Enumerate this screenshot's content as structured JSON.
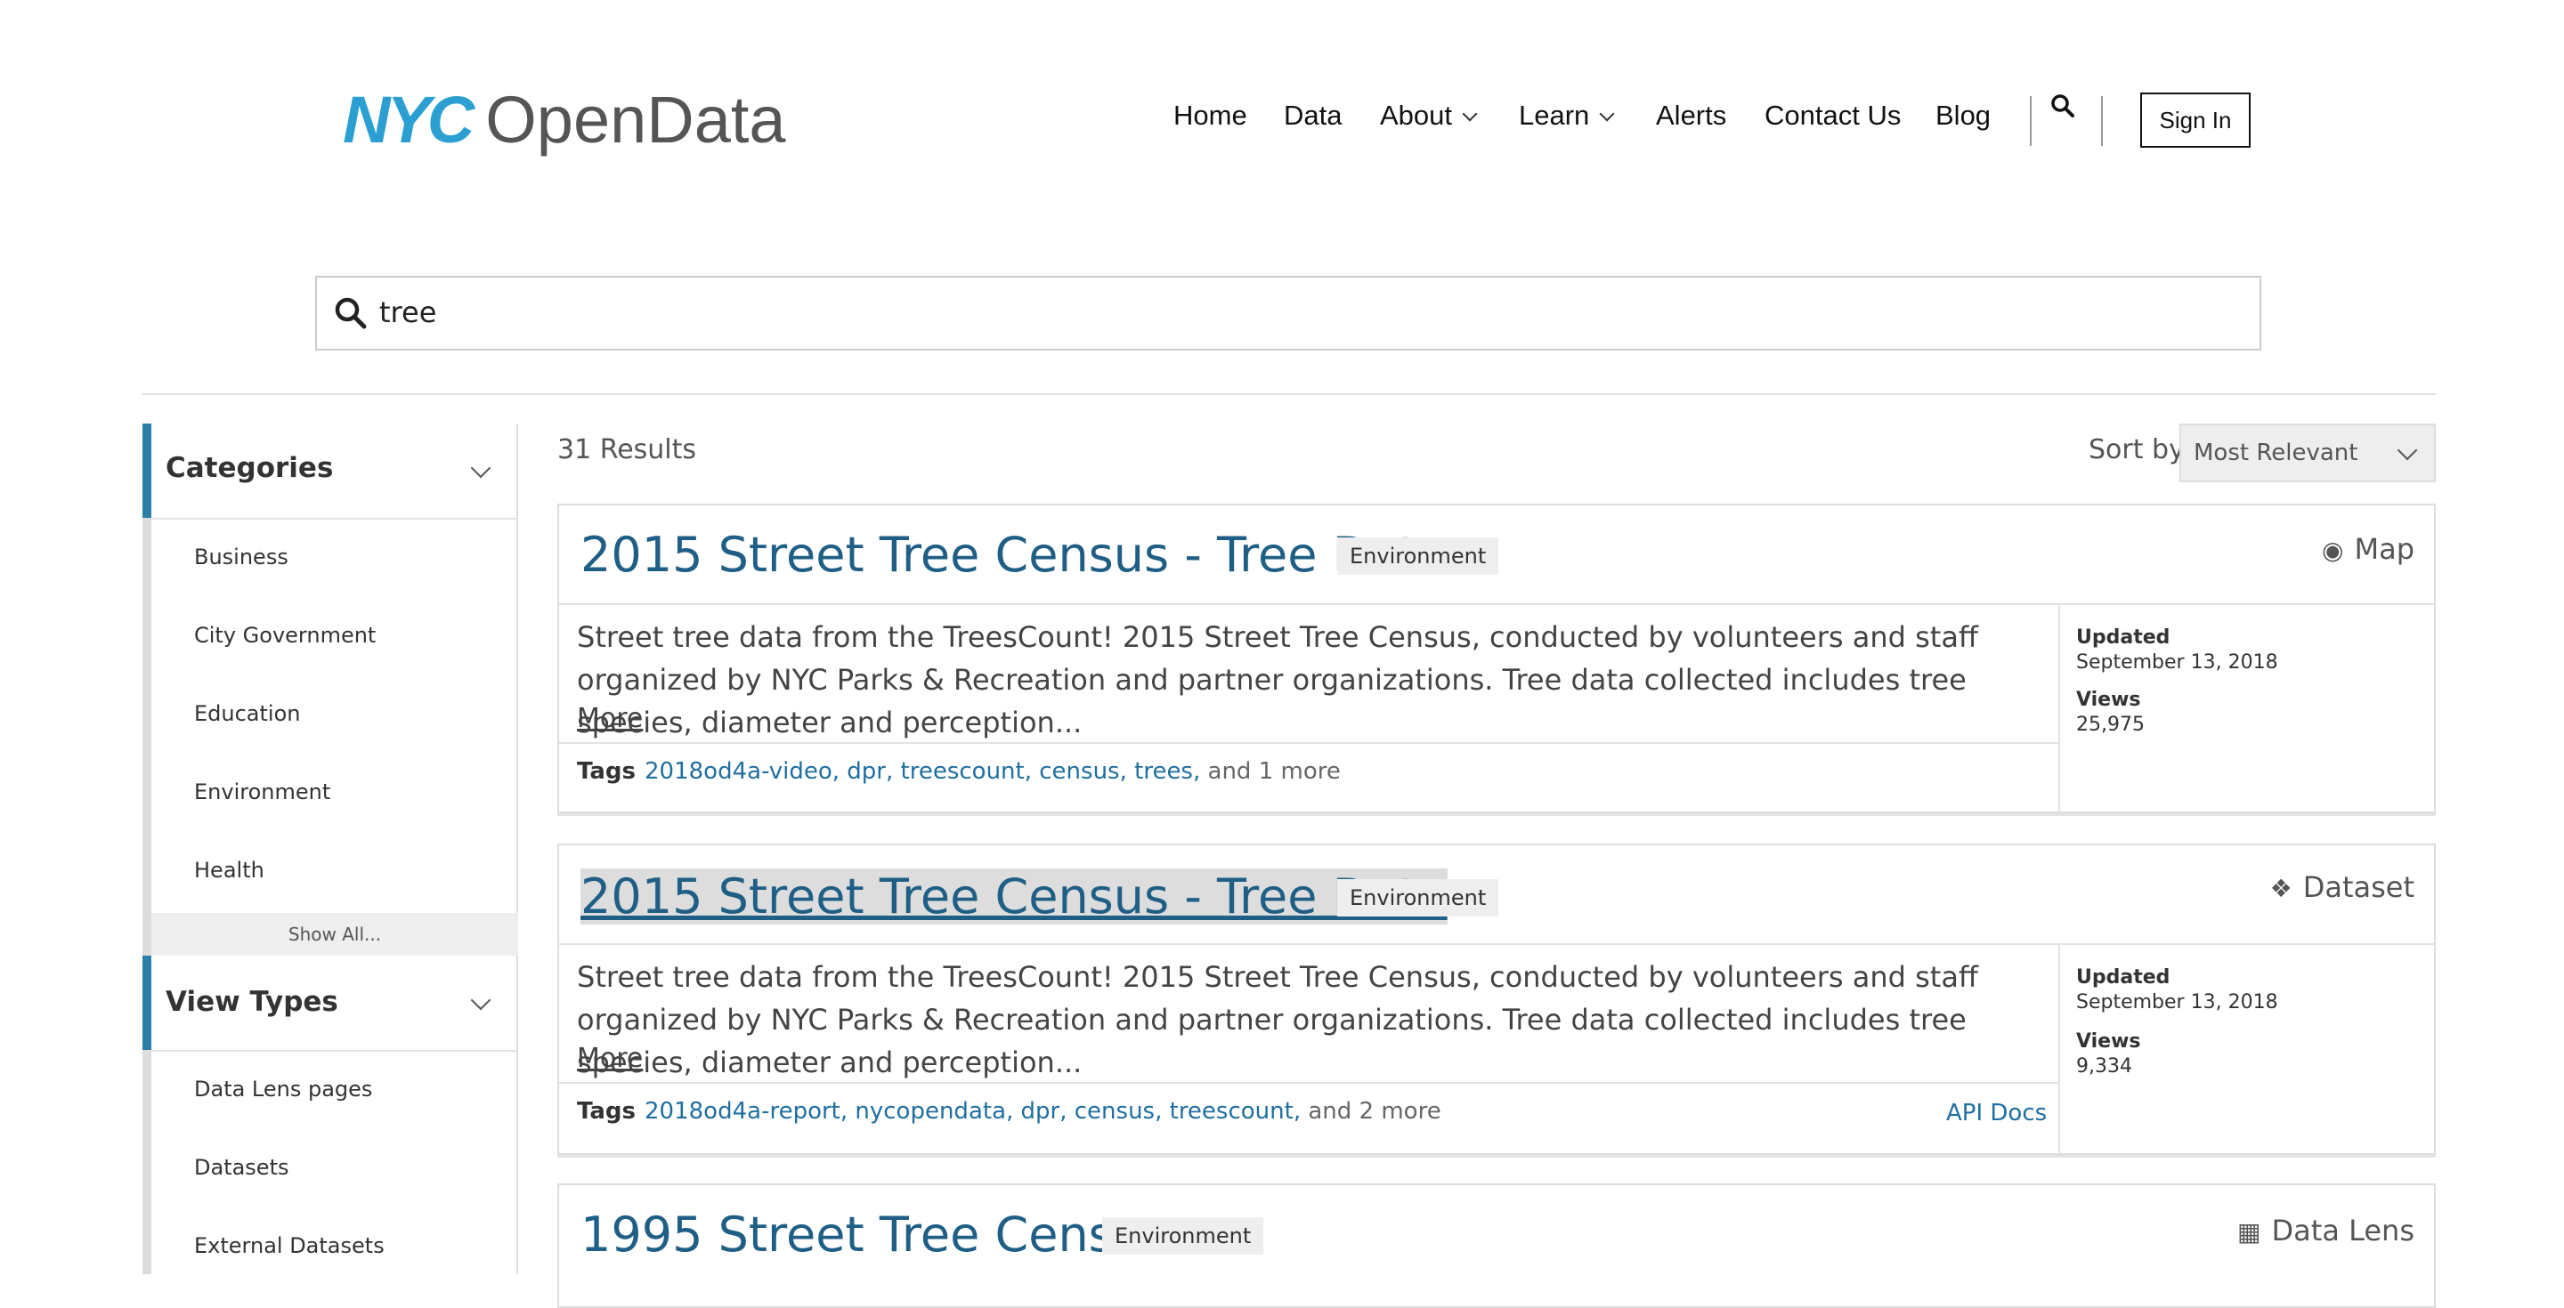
{
  "header": {
    "logo_nyc": "NYC",
    "logo_text": "OpenData",
    "nav": [
      "Home",
      "Data",
      "About",
      "Learn",
      "Alerts",
      "Contact Us",
      "Blog"
    ],
    "sign_in": "Sign In"
  },
  "search": {
    "query": "tree"
  },
  "sidebar": {
    "categories_title": "Categories",
    "categories": [
      "Business",
      "City Government",
      "Education",
      "Environment",
      "Health"
    ],
    "show_all": "Show All...",
    "view_types_title": "View Types",
    "view_types": [
      "Data Lens pages",
      "Datasets",
      "External Datasets"
    ]
  },
  "results": {
    "count": "31 Results",
    "sort_label": "Sort by",
    "sort_value": "Most Relevant",
    "items": [
      {
        "title": "2015 Street Tree Census - Tree Data",
        "category": "Environment",
        "type": "Map",
        "desc": "Street tree data from the TreesCount! 2015 Street Tree Census, conducted by volunteers and staff organized by NYC Parks & Recreation and partner organizations. Tree data collected includes tree species, diameter and perception...",
        "more": "More",
        "tags_label": "Tags",
        "tags": "2018od4a-video, dpr, treescount, census, trees,",
        "tags_more": " and 1 more",
        "updated_label": "Updated",
        "updated": "September 13, 2018",
        "views_label": "Views",
        "views": "25,975"
      },
      {
        "title": "2015 Street Tree Census - Tree Data",
        "category": "Environment",
        "type": "Dataset",
        "desc": "Street tree data from the TreesCount! 2015 Street Tree Census, conducted by volunteers and staff organized by NYC Parks & Recreation and partner organizations. Tree data collected includes tree species, diameter and perception...",
        "more": "More",
        "tags_label": "Tags",
        "tags": "2018od4a-report, nycopendata, dpr, census, treescount,",
        "tags_more": " and 2 more",
        "api": "API Docs",
        "updated_label": "Updated",
        "updated": "September 13, 2018",
        "views_label": "Views",
        "views": "9,334"
      },
      {
        "title": "1995 Street Tree Census",
        "category": "Environment",
        "type": "Data Lens"
      }
    ]
  }
}
